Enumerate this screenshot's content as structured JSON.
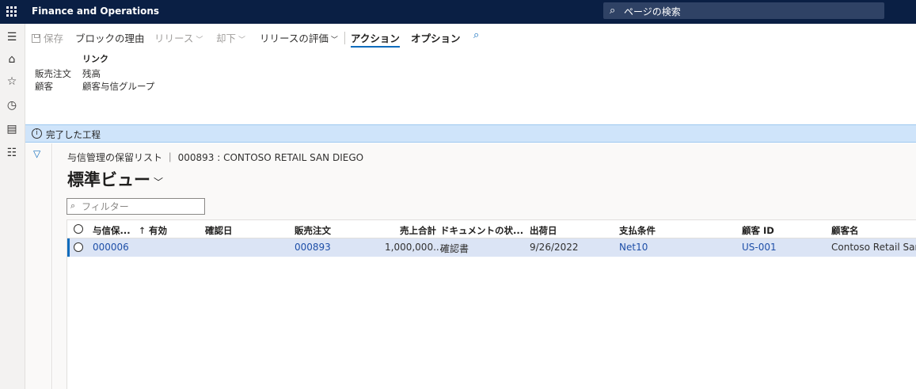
{
  "app": {
    "title": "Finance and Operations"
  },
  "search": {
    "placeholder": "ページの検索"
  },
  "rail": {
    "icons": [
      "menu-icon",
      "home-icon",
      "star-icon",
      "clock-icon",
      "workspace-icon",
      "list-icon"
    ]
  },
  "actionpane": {
    "save": "保存",
    "block_reason": "ブロックの理由",
    "release": "リリース",
    "reject": "却下",
    "release_eval": "リリースの評価",
    "tab_action": "アクション",
    "tab_options": "オプション",
    "links_group": "リンク",
    "rows": [
      {
        "label": "販売注文",
        "link": "残高"
      },
      {
        "label": "顧客",
        "link": "顧客与信グループ"
      }
    ]
  },
  "message": {
    "text": "完了した工程"
  },
  "page": {
    "caption": "与信管理の保留リスト ｜ 000893 : CONTOSO RETAIL SAN DIEGO",
    "view_name": "標準ビュー",
    "filter_placeholder": "フィルター"
  },
  "grid": {
    "columns": [
      "与信保...",
      "有効",
      "確認日",
      "販売注文",
      "売上合計",
      "ドキュメントの状...",
      "出荷日",
      "支払条件",
      "顧客 ID",
      "顧客名"
    ],
    "rows": [
      [
        "000006",
        "",
        "",
        "000893",
        "1,000,000....",
        "確認書",
        "9/26/2022",
        "Net10",
        "US-001",
        "Contoso Retail San D"
      ]
    ]
  },
  "colors": {
    "topbar": "#0a1f44",
    "accent": "#0f6cbd",
    "selected_row": "#dbe4f5",
    "message_bar": "#cfe4fa"
  }
}
